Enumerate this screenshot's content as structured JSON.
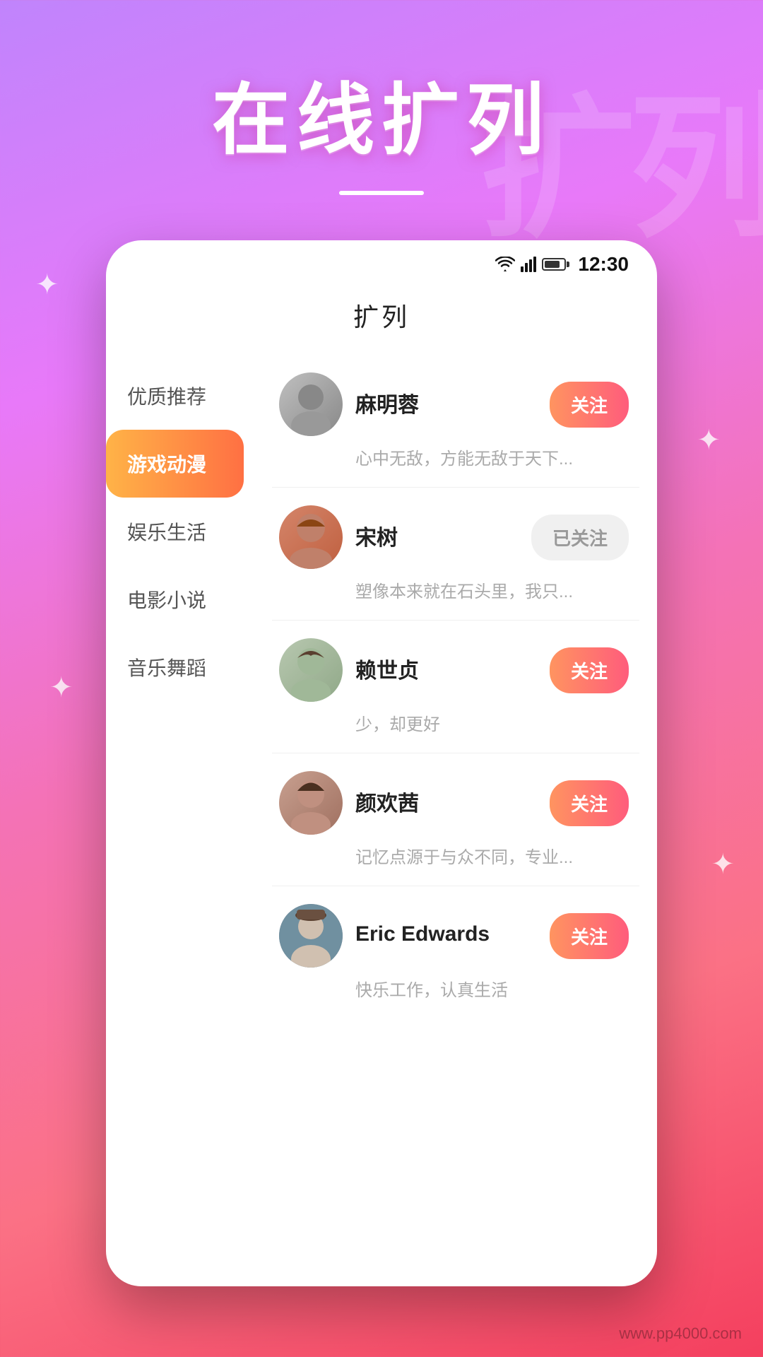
{
  "background": {
    "bgText": "扩列"
  },
  "hero": {
    "title": "在线扩列",
    "divider": true
  },
  "phone": {
    "statusBar": {
      "time": "12:30"
    },
    "header": {
      "title": "扩列"
    },
    "sidebar": {
      "items": [
        {
          "id": "quality",
          "label": "优质推荐",
          "active": false
        },
        {
          "id": "game",
          "label": "游戏动漫",
          "active": true
        },
        {
          "id": "entertainment",
          "label": "娱乐生活",
          "active": false
        },
        {
          "id": "movie",
          "label": "电影小说",
          "active": false
        },
        {
          "id": "music",
          "label": "音乐舞蹈",
          "active": false
        }
      ]
    },
    "users": [
      {
        "id": 1,
        "name": "麻明蓉",
        "desc": "心中无敌，方能无敌于天下...",
        "followState": "follow",
        "followLabel": "关注",
        "avatarEmoji": "👨"
      },
      {
        "id": 2,
        "name": "宋树",
        "desc": "塑像本来就在石头里，我只...",
        "followState": "following",
        "followLabel": "已关注",
        "avatarEmoji": "👩"
      },
      {
        "id": 3,
        "name": "赖世贞",
        "desc": "少，却更好",
        "followState": "follow",
        "followLabel": "关注",
        "avatarEmoji": "🙍"
      },
      {
        "id": 4,
        "name": "颜欢茜",
        "desc": "记忆点源于与众不同，专业...",
        "followState": "follow",
        "followLabel": "关注",
        "avatarEmoji": "👩"
      },
      {
        "id": 5,
        "name": "Eric Edwards",
        "desc": "快乐工作，认真生活",
        "followState": "follow",
        "followLabel": "关注",
        "avatarEmoji": "👩"
      }
    ]
  },
  "watermark": "www.pp4000.com"
}
